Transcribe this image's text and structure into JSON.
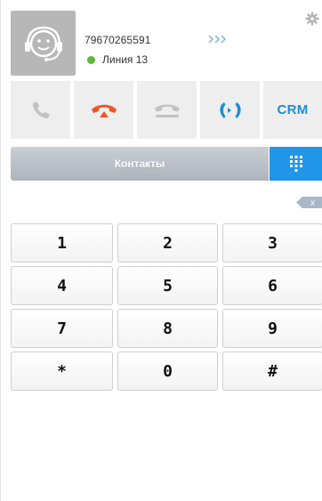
{
  "header": {
    "phone_number": "79670265591",
    "line_label": "Линия 13",
    "line_status_color": "#5aba3c",
    "icons": [
      "user-headset-icon",
      "forward-arrows-icon",
      "gear-icon"
    ]
  },
  "actions": [
    {
      "name": "call-button",
      "icon": "phone-icon",
      "color": "#c2c2c2"
    },
    {
      "name": "hangup-button",
      "icon": "hangup-phone-icon",
      "color": "#f0552a"
    },
    {
      "name": "hold-button",
      "icon": "hold-phone-icon",
      "color": "#c2c2c2"
    },
    {
      "name": "transfer-button",
      "icon": "transfer-icon",
      "color": "#1a8ed8"
    },
    {
      "name": "crm-button",
      "label": "CRM",
      "color": "#1a8ed8"
    }
  ],
  "contacts": {
    "label": "Контакты"
  },
  "dialpad_toggle": {
    "icon": "dialpad-grid-icon",
    "color": "#2196e8"
  },
  "backspace": {
    "label": "x"
  },
  "keypad": {
    "keys": [
      "1",
      "2",
      "3",
      "4",
      "5",
      "6",
      "7",
      "8",
      "9",
      "*",
      "0",
      "#"
    ]
  }
}
